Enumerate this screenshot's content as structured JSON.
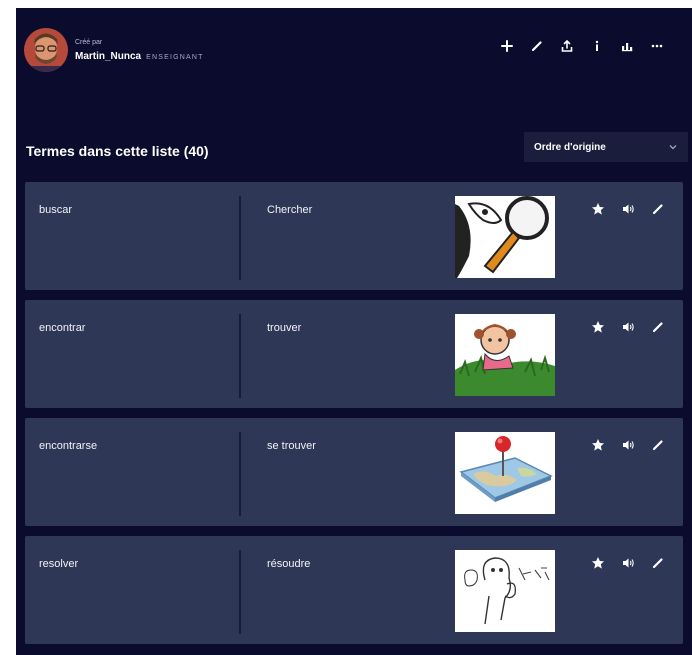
{
  "author": {
    "created_by": "Créé par",
    "name": "Martin_Nunca",
    "role": "ENSEIGNANT"
  },
  "toolbar": {
    "icons": [
      "plus-icon",
      "pencil-icon",
      "share-icon",
      "info-icon",
      "stats-icon",
      "more-icon"
    ]
  },
  "list": {
    "title": "Termes dans cette liste (40)",
    "sort_label": "Ordre d'origine"
  },
  "terms": [
    {
      "term": "buscar",
      "definition": "Chercher",
      "image": "magnifying-glass-cartoon"
    },
    {
      "term": "encontrar",
      "definition": "trouver",
      "image": "girl-in-grass-cartoon"
    },
    {
      "term": "encontrarse",
      "definition": "se trouver",
      "image": "map-pin-on-map"
    },
    {
      "term": "resolver",
      "definition": "résoudre",
      "image": "thinking-person-sketch"
    }
  ],
  "colors": {
    "background": "#0b0b2e",
    "card": "#2e3856",
    "select": "#1a1d3c",
    "text": "#ffffff",
    "muted": "#b9bdd6"
  }
}
